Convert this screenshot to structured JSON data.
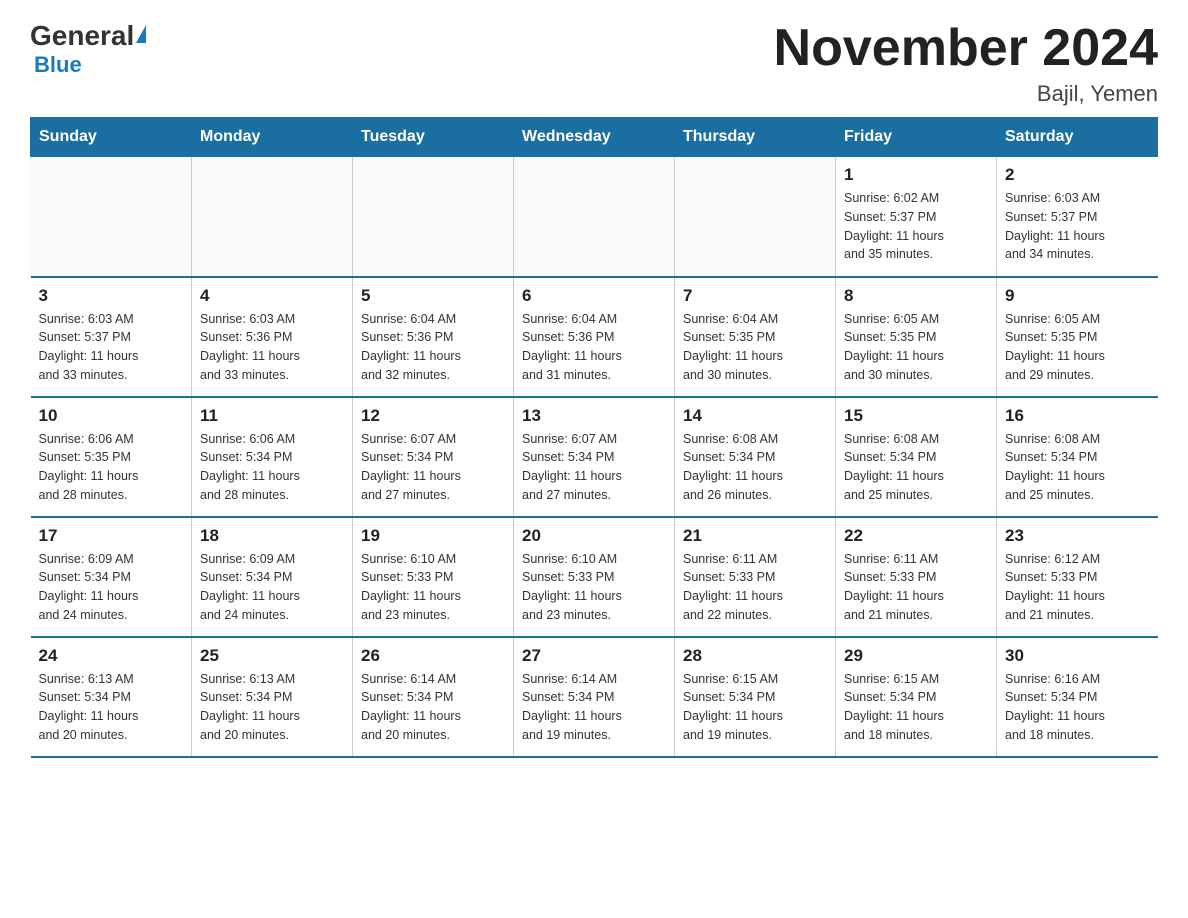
{
  "logo": {
    "general": "General",
    "blue": "Blue",
    "triangle": "▲"
  },
  "header": {
    "month_title": "November 2024",
    "location": "Bajil, Yemen"
  },
  "weekdays": [
    "Sunday",
    "Monday",
    "Tuesday",
    "Wednesday",
    "Thursday",
    "Friday",
    "Saturday"
  ],
  "weeks": [
    [
      {
        "day": "",
        "info": ""
      },
      {
        "day": "",
        "info": ""
      },
      {
        "day": "",
        "info": ""
      },
      {
        "day": "",
        "info": ""
      },
      {
        "day": "",
        "info": ""
      },
      {
        "day": "1",
        "info": "Sunrise: 6:02 AM\nSunset: 5:37 PM\nDaylight: 11 hours\nand 35 minutes."
      },
      {
        "day": "2",
        "info": "Sunrise: 6:03 AM\nSunset: 5:37 PM\nDaylight: 11 hours\nand 34 minutes."
      }
    ],
    [
      {
        "day": "3",
        "info": "Sunrise: 6:03 AM\nSunset: 5:37 PM\nDaylight: 11 hours\nand 33 minutes."
      },
      {
        "day": "4",
        "info": "Sunrise: 6:03 AM\nSunset: 5:36 PM\nDaylight: 11 hours\nand 33 minutes."
      },
      {
        "day": "5",
        "info": "Sunrise: 6:04 AM\nSunset: 5:36 PM\nDaylight: 11 hours\nand 32 minutes."
      },
      {
        "day": "6",
        "info": "Sunrise: 6:04 AM\nSunset: 5:36 PM\nDaylight: 11 hours\nand 31 minutes."
      },
      {
        "day": "7",
        "info": "Sunrise: 6:04 AM\nSunset: 5:35 PM\nDaylight: 11 hours\nand 30 minutes."
      },
      {
        "day": "8",
        "info": "Sunrise: 6:05 AM\nSunset: 5:35 PM\nDaylight: 11 hours\nand 30 minutes."
      },
      {
        "day": "9",
        "info": "Sunrise: 6:05 AM\nSunset: 5:35 PM\nDaylight: 11 hours\nand 29 minutes."
      }
    ],
    [
      {
        "day": "10",
        "info": "Sunrise: 6:06 AM\nSunset: 5:35 PM\nDaylight: 11 hours\nand 28 minutes."
      },
      {
        "day": "11",
        "info": "Sunrise: 6:06 AM\nSunset: 5:34 PM\nDaylight: 11 hours\nand 28 minutes."
      },
      {
        "day": "12",
        "info": "Sunrise: 6:07 AM\nSunset: 5:34 PM\nDaylight: 11 hours\nand 27 minutes."
      },
      {
        "day": "13",
        "info": "Sunrise: 6:07 AM\nSunset: 5:34 PM\nDaylight: 11 hours\nand 27 minutes."
      },
      {
        "day": "14",
        "info": "Sunrise: 6:08 AM\nSunset: 5:34 PM\nDaylight: 11 hours\nand 26 minutes."
      },
      {
        "day": "15",
        "info": "Sunrise: 6:08 AM\nSunset: 5:34 PM\nDaylight: 11 hours\nand 25 minutes."
      },
      {
        "day": "16",
        "info": "Sunrise: 6:08 AM\nSunset: 5:34 PM\nDaylight: 11 hours\nand 25 minutes."
      }
    ],
    [
      {
        "day": "17",
        "info": "Sunrise: 6:09 AM\nSunset: 5:34 PM\nDaylight: 11 hours\nand 24 minutes."
      },
      {
        "day": "18",
        "info": "Sunrise: 6:09 AM\nSunset: 5:34 PM\nDaylight: 11 hours\nand 24 minutes."
      },
      {
        "day": "19",
        "info": "Sunrise: 6:10 AM\nSunset: 5:33 PM\nDaylight: 11 hours\nand 23 minutes."
      },
      {
        "day": "20",
        "info": "Sunrise: 6:10 AM\nSunset: 5:33 PM\nDaylight: 11 hours\nand 23 minutes."
      },
      {
        "day": "21",
        "info": "Sunrise: 6:11 AM\nSunset: 5:33 PM\nDaylight: 11 hours\nand 22 minutes."
      },
      {
        "day": "22",
        "info": "Sunrise: 6:11 AM\nSunset: 5:33 PM\nDaylight: 11 hours\nand 21 minutes."
      },
      {
        "day": "23",
        "info": "Sunrise: 6:12 AM\nSunset: 5:33 PM\nDaylight: 11 hours\nand 21 minutes."
      }
    ],
    [
      {
        "day": "24",
        "info": "Sunrise: 6:13 AM\nSunset: 5:34 PM\nDaylight: 11 hours\nand 20 minutes."
      },
      {
        "day": "25",
        "info": "Sunrise: 6:13 AM\nSunset: 5:34 PM\nDaylight: 11 hours\nand 20 minutes."
      },
      {
        "day": "26",
        "info": "Sunrise: 6:14 AM\nSunset: 5:34 PM\nDaylight: 11 hours\nand 20 minutes."
      },
      {
        "day": "27",
        "info": "Sunrise: 6:14 AM\nSunset: 5:34 PM\nDaylight: 11 hours\nand 19 minutes."
      },
      {
        "day": "28",
        "info": "Sunrise: 6:15 AM\nSunset: 5:34 PM\nDaylight: 11 hours\nand 19 minutes."
      },
      {
        "day": "29",
        "info": "Sunrise: 6:15 AM\nSunset: 5:34 PM\nDaylight: 11 hours\nand 18 minutes."
      },
      {
        "day": "30",
        "info": "Sunrise: 6:16 AM\nSunset: 5:34 PM\nDaylight: 11 hours\nand 18 minutes."
      }
    ]
  ]
}
